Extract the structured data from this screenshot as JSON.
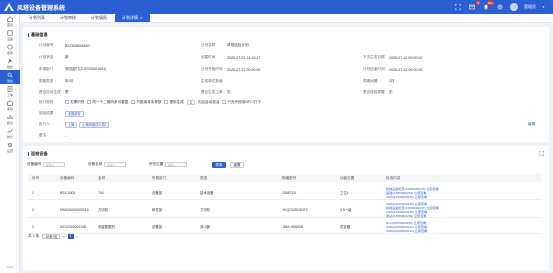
{
  "header": {
    "title": "风塔设备管理系统",
    "user": "管理员",
    "badges": {
      "messages": "9",
      "notifications": "99+"
    }
  },
  "sidebar": {
    "items": [
      {
        "label": "首页",
        "icon": "home-icon"
      },
      {
        "label": "设备",
        "icon": "device-icon"
      },
      {
        "label": "备件",
        "icon": "parts-icon"
      },
      {
        "label": "维护",
        "icon": "wrench-icon"
      },
      {
        "label": "巡检",
        "icon": "inspect-icon"
      },
      {
        "label": "工单",
        "icon": "order-icon"
      },
      {
        "label": "库存",
        "icon": "stock-icon"
      },
      {
        "label": "报表",
        "icon": "chart-icon"
      },
      {
        "label": "统计",
        "icon": "stats-icon"
      },
      {
        "label": "设置",
        "icon": "gear-icon"
      }
    ],
    "version": "V3.0"
  },
  "tabs": [
    {
      "label": "计划列表"
    },
    {
      "label": "计划审核"
    },
    {
      "label": "计划填报"
    },
    {
      "label": "计划详情"
    }
  ],
  "info": {
    "title": "基础信息",
    "fields": {
      "plan_no": {
        "label": "计划编号",
        "value": "BX2508006562"
      },
      "plan_name": {
        "label": "计划名称",
        "value": "风塔巡检计划"
      },
      "plan_status": {
        "label": "计划状态",
        "value": "新"
      },
      "created_at": {
        "label": "创建时间",
        "value": "2025-07-01 14:13:27"
      },
      "next_time": {
        "label": "下次生成日期",
        "value": "2025-07-12 00:00:00"
      },
      "dept": {
        "label": "申请部门",
        "value": "测试部门(ZJZY00001051)"
      },
      "start_date": {
        "label": "计划开始时间",
        "value": "2025-07-07 00:00:00"
      },
      "end_date": {
        "label": "计划结束时间",
        "value": "2025-07-12 00:00:00"
      },
      "cycle_type": {
        "label": "周期类型",
        "value": "年/月"
      },
      "cycle_unit": {
        "label": "生成单位数值",
        "value": ""
      },
      "cycle_value": {
        "label": "周期间隔",
        "value": "1日"
      },
      "gen_type": {
        "label": "是否自动生成",
        "value": "是"
      },
      "work_type": {
        "label": "是否生成工单",
        "value": "无"
      },
      "remind": {
        "label": "是否提前提醒",
        "value": "无"
      },
      "exec_rule": {
        "label": "执行规则"
      },
      "rule_opt1": "无需识别",
      "rule_opt2": "同一个二维码多可重复",
      "rule_opt3": "只能填写本考核",
      "rule_opt4": "提前生成",
      "rule_days": "2",
      "rule_days_suffix": "天后自动激活",
      "rule_opt5": "只允许使用NFC/打卡",
      "result": {
        "label": "巡检结果",
        "value": "无需填写"
      },
      "executors": {
        "label": "执行人",
        "tags": [
          "上海",
          "上海市测试人员1"
        ]
      },
      "edit_link": "编辑",
      "remark": {
        "label": "备注",
        "value": "-"
      }
    }
  },
  "devices": {
    "title": "巡检设备",
    "search": {
      "code_label": "设备编号",
      "code_placeholder": "请输入",
      "name_label": "设备名称",
      "name_placeholder": "请输入",
      "location_label": "所在位置",
      "location_placeholder": "请输入",
      "search_btn": "搜索",
      "reset_btn": "重置"
    },
    "columns": [
      "序号",
      "设备编码",
      "名称",
      "所属部门",
      "类型",
      "规格型号",
      "功能位置",
      "检查内容"
    ],
    "rows": [
      {
        "no": "1",
        "code": "BSX-0001",
        "name": "744",
        "dept": "设备部",
        "type": "技术设备",
        "model": "15087111",
        "position": "工位1",
        "docs": [
          "机械设备检查(ZJ000000233) 立即查看",
          "基础(ZJ000000234) 立即查看",
          "2025(ZJ000000235) 立即查看"
        ],
        "extra": "2个"
      },
      {
        "no": "2",
        "code": "DBS05AS0000015",
        "name": "刀切机",
        "dept": "研发部",
        "type": "刀切机",
        "model": "YKQ23Z8C5DF2",
        "position": "4.5一级",
        "docs": [
          "2025(ZJ000000236) 立即查看",
          "机械设备检查(ZJ000000237) 立即查看",
          "2025(ZJ000000238) 立即查看",
          "测试(ZJ000000239) 立即查看"
        ],
        "extra": "2个"
      },
      {
        "no": "3",
        "code": "DEV2025000148",
        "name": "测量数据机",
        "dept": "设备部",
        "type": "测-1器",
        "model": "JMIX-H5600N",
        "position": "供证器",
        "docs": [
          "Nrm(ZJ000000240) 立即查看",
          "2025(ZJ000000241) 立即查看",
          "2025(ZJ000000242) 立即查看"
        ],
        "extra": "2个"
      }
    ],
    "pager": {
      "total": "共 3 条",
      "page_size": "10条/页",
      "current": "1"
    }
  }
}
